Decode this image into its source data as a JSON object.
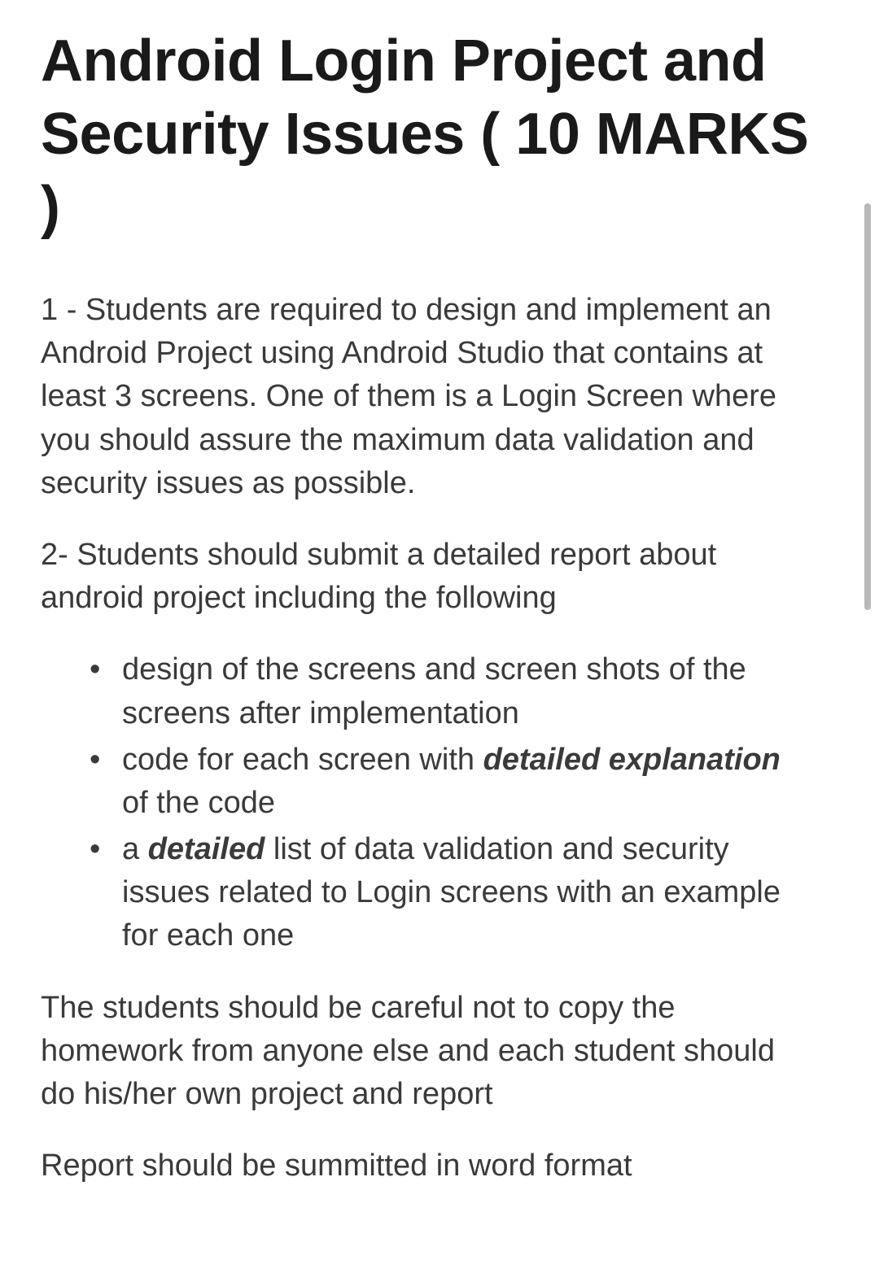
{
  "title": "Android Login Project and Security Issues ( 10 MARKS )",
  "paragraphs": {
    "p1": "1 - Students are required to design and implement an Android Project  using Android Studio that contains at least 3 screens. One of them is a Login Screen where you should assure the maximum data validation and security issues as possible.",
    "p2": "2- Students should submit a detailed report about android project including the following",
    "p3": "The students should be careful not to copy the homework from anyone else and each student should do his/her own project and report",
    "p4": "Report should be summitted in word format"
  },
  "bullets": {
    "b1": "design of the screens and screen shots of the screens after implementation",
    "b2_pre": "code for each screen with ",
    "b2_em": "detailed explanation",
    "b2_post": " of the code",
    "b3_pre": "a ",
    "b3_em": "detailed",
    "b3_post": " list of data validation and security issues related to Login screens with an example for each one"
  }
}
